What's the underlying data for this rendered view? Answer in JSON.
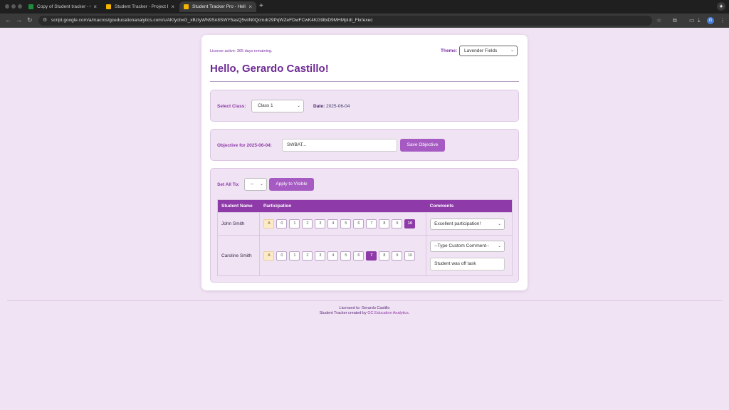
{
  "browser": {
    "tabs": [
      {
        "title": "Copy of Student tracker - Go",
        "favicon_color": "#1e8e3e"
      },
      {
        "title": "Student Tracker - Project Edi",
        "favicon_color": "#f4b400"
      },
      {
        "title": "Student Tracker Pro - Hello, G",
        "favicon_color": "#f4b400"
      }
    ],
    "url": "script.google.com/a/macros/gceducationanalytics.com/s/AKfycbxG_xBzIyWN9Sn8SWY5asQ5viIN0Qcmdr29PqWZeFDwFCwK4KG9lbiD9MHMpIdI_Fkr/exec",
    "profile_initial": "G"
  },
  "header": {
    "license_text": "License active: 365 days remaining.",
    "theme_label": "Theme:",
    "theme_value": "Lavender Fields",
    "greeting": "Hello, Gerardo Castillo!"
  },
  "class_panel": {
    "select_label": "Select Class:",
    "class_value": "Class 1",
    "date_label": "Date:",
    "date_value": "2025-06-04"
  },
  "objective_panel": {
    "label": "Objective for 2025-06-04:",
    "placeholder": "SWBAT...",
    "save_label": "Save Objective"
  },
  "tracker_panel": {
    "set_all_label": "Set All To:",
    "set_all_value": "--",
    "apply_label": "Apply to Visible",
    "columns": [
      "Student Name",
      "Participation",
      "Comments"
    ],
    "score_options": [
      "A",
      "0",
      "1",
      "2",
      "3",
      "4",
      "5",
      "6",
      "7",
      "8",
      "9",
      "10"
    ],
    "students": [
      {
        "name": "John Smith",
        "selected_score": "10",
        "comment": "Excellent participation!",
        "custom_comment": ""
      },
      {
        "name": "Caroline Smith",
        "selected_score": "7",
        "comment": "--Type Custom Comment--",
        "custom_comment": "Student was off task"
      }
    ]
  },
  "footer": {
    "licensed_to": "Licensed to: Gerardo Castillo",
    "created_by_prefix": "Student Tracker created by",
    "company": "GC Education Analytics."
  },
  "colors": {
    "accent": "#8e3aa8",
    "background": "#f0e3f3",
    "absent": "#fdebc8"
  }
}
